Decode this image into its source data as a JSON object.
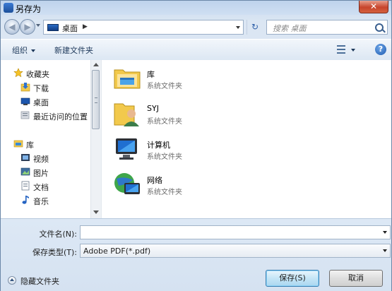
{
  "window": {
    "title": "另存为",
    "close_glyph": "✕"
  },
  "address": {
    "location": "桌面",
    "separator": "▶",
    "refresh_glyph": "↻"
  },
  "search": {
    "placeholder": "搜索 桌面"
  },
  "toolbar": {
    "organize_label": "组织",
    "new_folder_label": "新建文件夹",
    "help_glyph": "?"
  },
  "nav_pane": {
    "favorites": {
      "header": "收藏夹",
      "items": [
        {
          "label": "下载",
          "icon": "download-folder-icon"
        },
        {
          "label": "桌面",
          "icon": "desktop-icon"
        },
        {
          "label": "最近访问的位置",
          "icon": "recent-places-icon"
        }
      ]
    },
    "libraries": {
      "header": "库",
      "items": [
        {
          "label": "视频",
          "icon": "video-library-icon"
        },
        {
          "label": "图片",
          "icon": "picture-library-icon"
        },
        {
          "label": "文档",
          "icon": "document-library-icon"
        },
        {
          "label": "音乐",
          "icon": "music-library-icon"
        }
      ]
    }
  },
  "files": [
    {
      "name": "库",
      "type": "系统文件夹",
      "icon": "libraries-icon"
    },
    {
      "name": "SYJ",
      "type": "系统文件夹",
      "icon": "user-folder-icon"
    },
    {
      "name": "计算机",
      "type": "系统文件夹",
      "icon": "computer-icon"
    },
    {
      "name": "网络",
      "type": "系统文件夹",
      "icon": "network-icon"
    }
  ],
  "form": {
    "filename_label": "文件名(N):",
    "filename_value": "",
    "filetype_label": "保存类型(T):",
    "filetype_value": "Adobe PDF(*.pdf)"
  },
  "footer": {
    "hide_folders_label": "隐藏文件夹",
    "save_label": "保存(S)",
    "cancel_label": "取消"
  },
  "colors": {
    "accent": "#3c7fb1",
    "close": "#c7442c",
    "folder": "#f2c94c"
  }
}
